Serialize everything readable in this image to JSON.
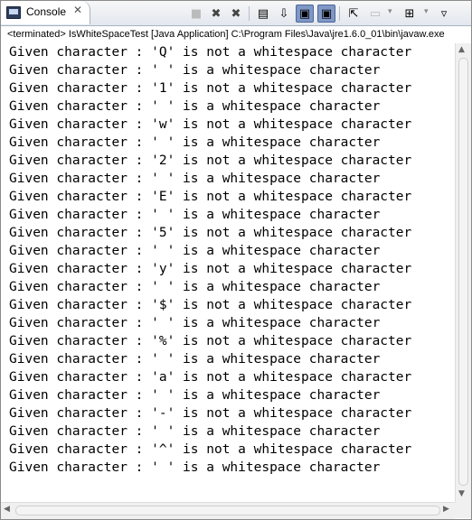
{
  "view": {
    "tab_label": "Console",
    "close_glyph": "✕"
  },
  "toolbar": [
    {
      "name": "terminate-icon",
      "glyph": "■",
      "state": "disabled"
    },
    {
      "name": "remove-launch-icon",
      "glyph": "✖",
      "state": "normal"
    },
    {
      "name": "remove-all-terminated-icon",
      "glyph": "✖",
      "state": "normal"
    },
    {
      "name": "clear-console-icon",
      "glyph": "▤",
      "state": "normal"
    },
    {
      "name": "scroll-lock-icon",
      "glyph": "⇩",
      "state": "normal"
    },
    {
      "name": "show-on-stdout-icon",
      "glyph": "▣",
      "state": "active"
    },
    {
      "name": "show-on-stderr-icon",
      "glyph": "▣",
      "state": "active"
    },
    {
      "name": "pin-console-icon",
      "glyph": "⇱",
      "state": "normal"
    },
    {
      "name": "display-console-icon",
      "glyph": "▭",
      "state": "disabled"
    },
    {
      "name": "open-console-icon",
      "glyph": "⊞",
      "state": "normal"
    },
    {
      "name": "view-menu-icon",
      "glyph": "▿",
      "state": "normal"
    }
  ],
  "status_text": "<terminated> IsWhiteSpaceTest [Java Application] C:\\Program Files\\Java\\jre1.6.0_01\\bin\\javaw.exe",
  "console_lines": [
    "Given character : 'Q' is not a whitespace character",
    "Given character : ' ' is a whitespace character",
    "Given character : '1' is not a whitespace character",
    "Given character : ' ' is a whitespace character",
    "Given character : 'w' is not a whitespace character",
    "Given character : ' ' is a whitespace character",
    "Given character : '2' is not a whitespace character",
    "Given character : ' ' is a whitespace character",
    "Given character : 'E' is not a whitespace character",
    "Given character : ' ' is a whitespace character",
    "Given character : '5' is not a whitespace character",
    "Given character : ' ' is a whitespace character",
    "Given character : 'y' is not a whitespace character",
    "Given character : ' ' is a whitespace character",
    "Given character : '$' is not a whitespace character",
    "Given character : ' ' is a whitespace character",
    "Given character : '%' is not a whitespace character",
    "Given character : ' ' is a whitespace character",
    "Given character : 'a' is not a whitespace character",
    "Given character : ' ' is a whitespace character",
    "Given character : '-' is not a whitespace character",
    "Given character : ' ' is a whitespace character",
    "Given character : '^' is not a whitespace character",
    "Given character : ' ' is a whitespace character"
  ]
}
